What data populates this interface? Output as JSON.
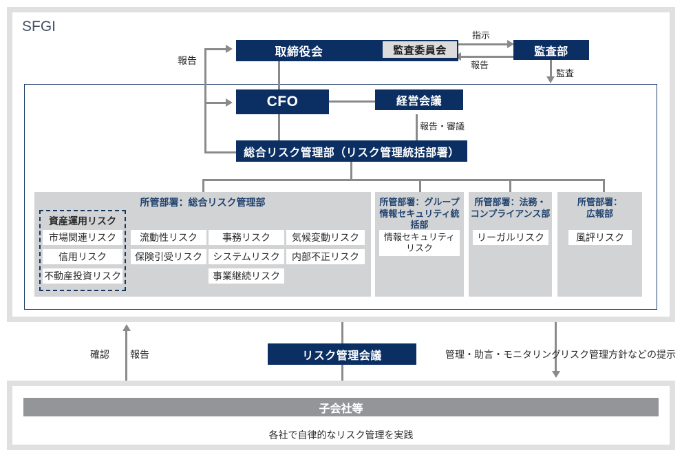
{
  "diagram": {
    "title": "SFGI",
    "nodes": {
      "board": "取締役会",
      "audit_committee": "監査委員会",
      "audit_department": "監査部",
      "cfo": "CFO",
      "management_meeting": "経営会議",
      "integrated_risk_dept": "総合リスク管理部（リスク管理統括部署）",
      "risk_management_meeting": "リスク管理会議",
      "subsidiaries": "子会社等",
      "subsidiaries_note": "各社で自律的なリスク管理を実践"
    },
    "edge_labels": {
      "report_to_board": "報告",
      "instruction": "指示",
      "report_to_committee": "報告",
      "audit": "監査",
      "report_deliberation": "報告・審議",
      "confirm": "確認",
      "report_up": "報告",
      "manage_advise_monitor": "管理・助言・モニタリング",
      "risk_policy_presentation": "リスク管理方針などの提示"
    },
    "departments": [
      {
        "id": "integrated-risk",
        "title": "所管部署：総合リスク管理部",
        "dashed_group": {
          "label": "資産運用リスク",
          "risks": [
            "市場関連リスク",
            "信用リスク",
            "不動産投資リスク"
          ]
        },
        "columns": [
          [
            "流動性リスク",
            "保険引受リスク"
          ],
          [
            "事務リスク",
            "システムリスク",
            "事業継続リスク"
          ],
          [
            "気候変動リスク",
            "内部不正リスク"
          ]
        ]
      },
      {
        "id": "group-infosec",
        "title": "所管部署：グループ\n情報セキュリティ統括部",
        "risks": [
          "情報セキュリティ\nリスク"
        ]
      },
      {
        "id": "legal-compliance",
        "title": "所管部署：法務・\nコンプライアンス部",
        "risks": [
          "リーガルリスク"
        ]
      },
      {
        "id": "public-relations",
        "title": "所管部署：\n広報部",
        "risks": [
          "風評リスク"
        ]
      }
    ],
    "colors": {
      "navy": "#0c2f63",
      "panel_border_navy": "#1a3a66",
      "outer_border_gray": "#e0e0e0",
      "dept_panel_gray": "#d2d3d5",
      "inset_gray": "#dcdcdc",
      "subsidiary_gray": "#939598",
      "line_gray": "#8a8a8a",
      "title_blue": "#21436e"
    }
  }
}
